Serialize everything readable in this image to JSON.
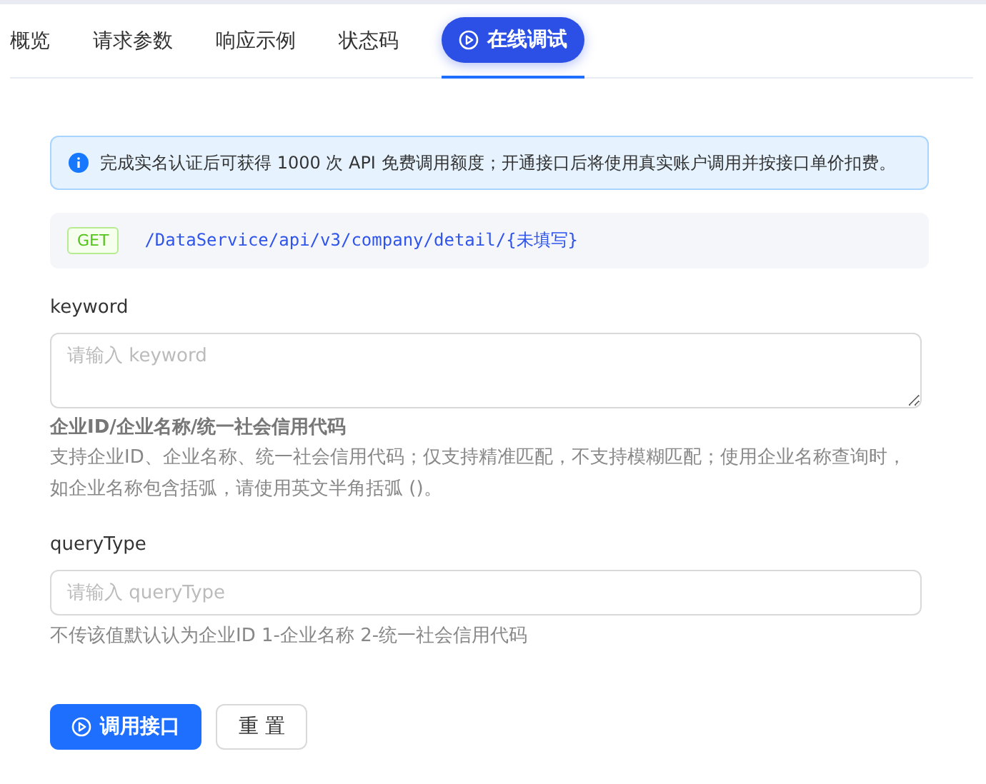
{
  "tabs": [
    {
      "label": "概览",
      "selected": false
    },
    {
      "label": "请求参数",
      "selected": false
    },
    {
      "label": "响应示例",
      "selected": false
    },
    {
      "label": "状态码",
      "selected": false
    },
    {
      "label": "在线调试",
      "selected": true
    }
  ],
  "notice": "完成实名认证后可获得 1000 次 API 免费调用额度；开通接口后将使用真实账户调用并按接口单价扣费。",
  "endpoint": {
    "method": "GET",
    "path": "/DataService/api/v3/company/detail/{未填写}"
  },
  "params": [
    {
      "kind": "textarea",
      "label": "keyword",
      "placeholder": "请输入 keyword",
      "help_title": "企业ID/企业名称/统一社会信用代码",
      "help": "支持企业ID、企业名称、统一社会信用代码；仅支持精准匹配，不支持模糊匹配；使用企业名称查询时，如企业名称包含括弧，请使用英文半角括弧 ()。"
    },
    {
      "kind": "input",
      "label": "queryType",
      "placeholder": "请输入 queryType",
      "help": "不传该值默认认为企业ID 1-企业名称 2-统一社会信用代码"
    }
  ],
  "buttons": [
    {
      "label": "调用接口",
      "kind": "primary"
    },
    {
      "label": "重 置",
      "kind": "default"
    }
  ]
}
